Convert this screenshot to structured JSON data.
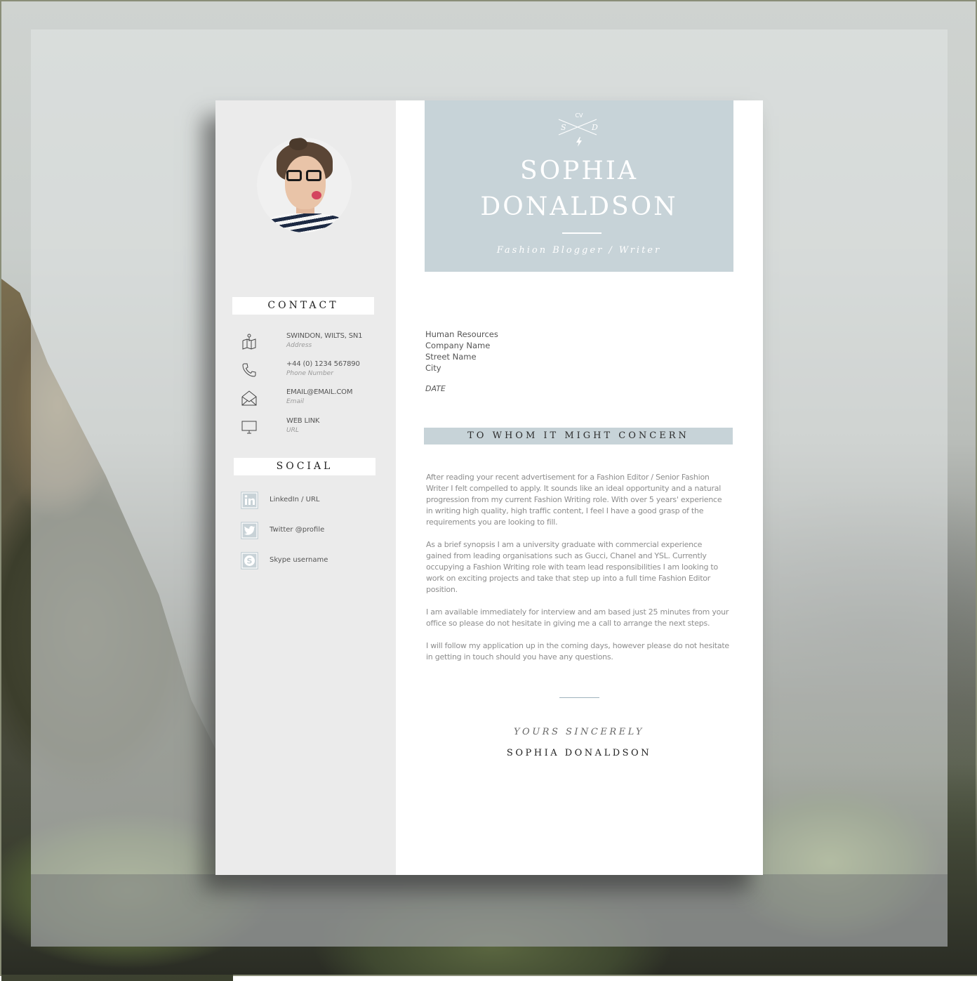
{
  "header": {
    "logo": {
      "top": "CV",
      "left": "S",
      "right": "D"
    },
    "first_name": "SOPHIA",
    "last_name": "DONALDSON",
    "subtitle": "Fashion Blogger / Writer"
  },
  "sidebar": {
    "contact_heading": "CONTACT",
    "contact": [
      {
        "icon": "map-icon",
        "value": "SWINDON, WILTS, SN1",
        "label": "Address"
      },
      {
        "icon": "phone-icon",
        "value": "+44 (0) 1234 567890",
        "label": "Phone Number"
      },
      {
        "icon": "envelope-icon",
        "value": "EMAIL@EMAIL.COM",
        "label": "Email"
      },
      {
        "icon": "monitor-icon",
        "value": "WEB LINK",
        "label": "URL"
      }
    ],
    "social_heading": "SOCIAL",
    "social": [
      {
        "icon": "linkedin-icon",
        "text": "LinkedIn / URL"
      },
      {
        "icon": "twitter-icon",
        "text": "Twitter @profile"
      },
      {
        "icon": "skype-icon",
        "text": "Skype username"
      }
    ]
  },
  "recipient": {
    "lines": [
      "Human Resources",
      "Company Name",
      "Street Name",
      "City"
    ],
    "date": "DATE"
  },
  "salutation": "TO WHOM IT MIGHT CONCERN",
  "body": [
    "After reading your recent advertisement for a Fashion Editor / Senior Fashion Writer I felt compelled to apply.  It sounds like an ideal opportunity and a natural progression from my current Fashion Writing role.  With over 5 years' experience in writing high quality, high traffic content, I feel I have a good grasp of the requirements you are looking to fill.",
    "As a brief synopsis I am a university graduate with commercial experience gained from leading organisations such as Gucci, Chanel and YSL.  Currently occupying a Fashion Writing role with team lead responsibilities I am looking to work on exciting projects and take that step up into a full time Fashion Editor position.",
    "I am available immediately for interview and am based just 25 minutes from your office so please do not hesitate in giving me a call to arrange the next steps.",
    "I will follow my application up in the coming days, however please do not hesitate in getting in touch should you have any questions."
  ],
  "closing": "YOURS SINCERELY",
  "signature": "SOPHIA DONALDSON",
  "colors": {
    "accent": "#c7d3d8",
    "sidebar": "#ebebeb",
    "social_icon": "#c8d2d7"
  }
}
